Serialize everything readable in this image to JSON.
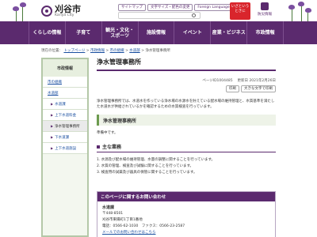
{
  "header": {
    "logo_jp": "刈谷市",
    "logo_en": "Kariya City",
    "util_links": [
      "サイトマップ",
      "文字サイズ・配色の変更",
      "Foreign Language"
    ],
    "search_placeholder": "",
    "emergency": [
      "いざという",
      "ときに"
    ],
    "disaster": "防災情報"
  },
  "nav": [
    "くらしの情報",
    "子育て",
    "観光・文化・\nスポーツ",
    "施設情報",
    "イベント",
    "産業・ビジネス",
    "市政情報"
  ],
  "breadcrumb": {
    "label": "現在の位置",
    "items": [
      "トップページ",
      "市政情報",
      "市の組織",
      "水道部"
    ],
    "current": "浄水管理事務所"
  },
  "sidebar": {
    "heading": "市政情報",
    "items": [
      {
        "label": "市の組織",
        "level": 1
      },
      {
        "label": "水道部",
        "level": 1
      },
      {
        "label": "水道課",
        "level": 2
      },
      {
        "label": "上下水道料金",
        "level": 2
      },
      {
        "label": "浄水管理事務所",
        "level": 2,
        "current": true
      },
      {
        "label": "下水道課",
        "level": 2
      },
      {
        "label": "上下水道施設",
        "level": 2
      }
    ]
  },
  "main": {
    "title": "浄水管理事務所",
    "page_id": "ページID1004485",
    "updated": "更新日 2021年2月26日",
    "tools": [
      "印刷",
      "大きな文字で印刷"
    ],
    "intro": "浄水管理事務所では、水道水を作っている浄水場の水源水を貯えている配水場の維持管理と、水質基準を満たした水道水が供給されているかを確認するための水質検査を行っています。",
    "section_heading": "浄水管理事務所",
    "section_text": "準備中です。",
    "duties_heading": "主な業務",
    "duties": [
      "1. 水源及び配水場の維持管理、水量の調整に関することを行っています。",
      "2. 水質の管理、検査及び試験に関することを行っています。",
      "3. 検査用の試薬及び器具の保管に関することを行っています。"
    ]
  },
  "contact": {
    "heading": "このページに関するお問い合わせ",
    "dept": "水道課",
    "zip": "〒448-8501",
    "address": "刈谷市東陽町1丁目1番地",
    "phone": "電話：0566-62-1030　ファクス：0566-23-2587",
    "mail_link": "メールでのお問い合わせはこちら"
  },
  "colors": {
    "brand": "#5b2a6e",
    "accent_green": "#6d9b4f",
    "emergency": "#d9252c"
  }
}
